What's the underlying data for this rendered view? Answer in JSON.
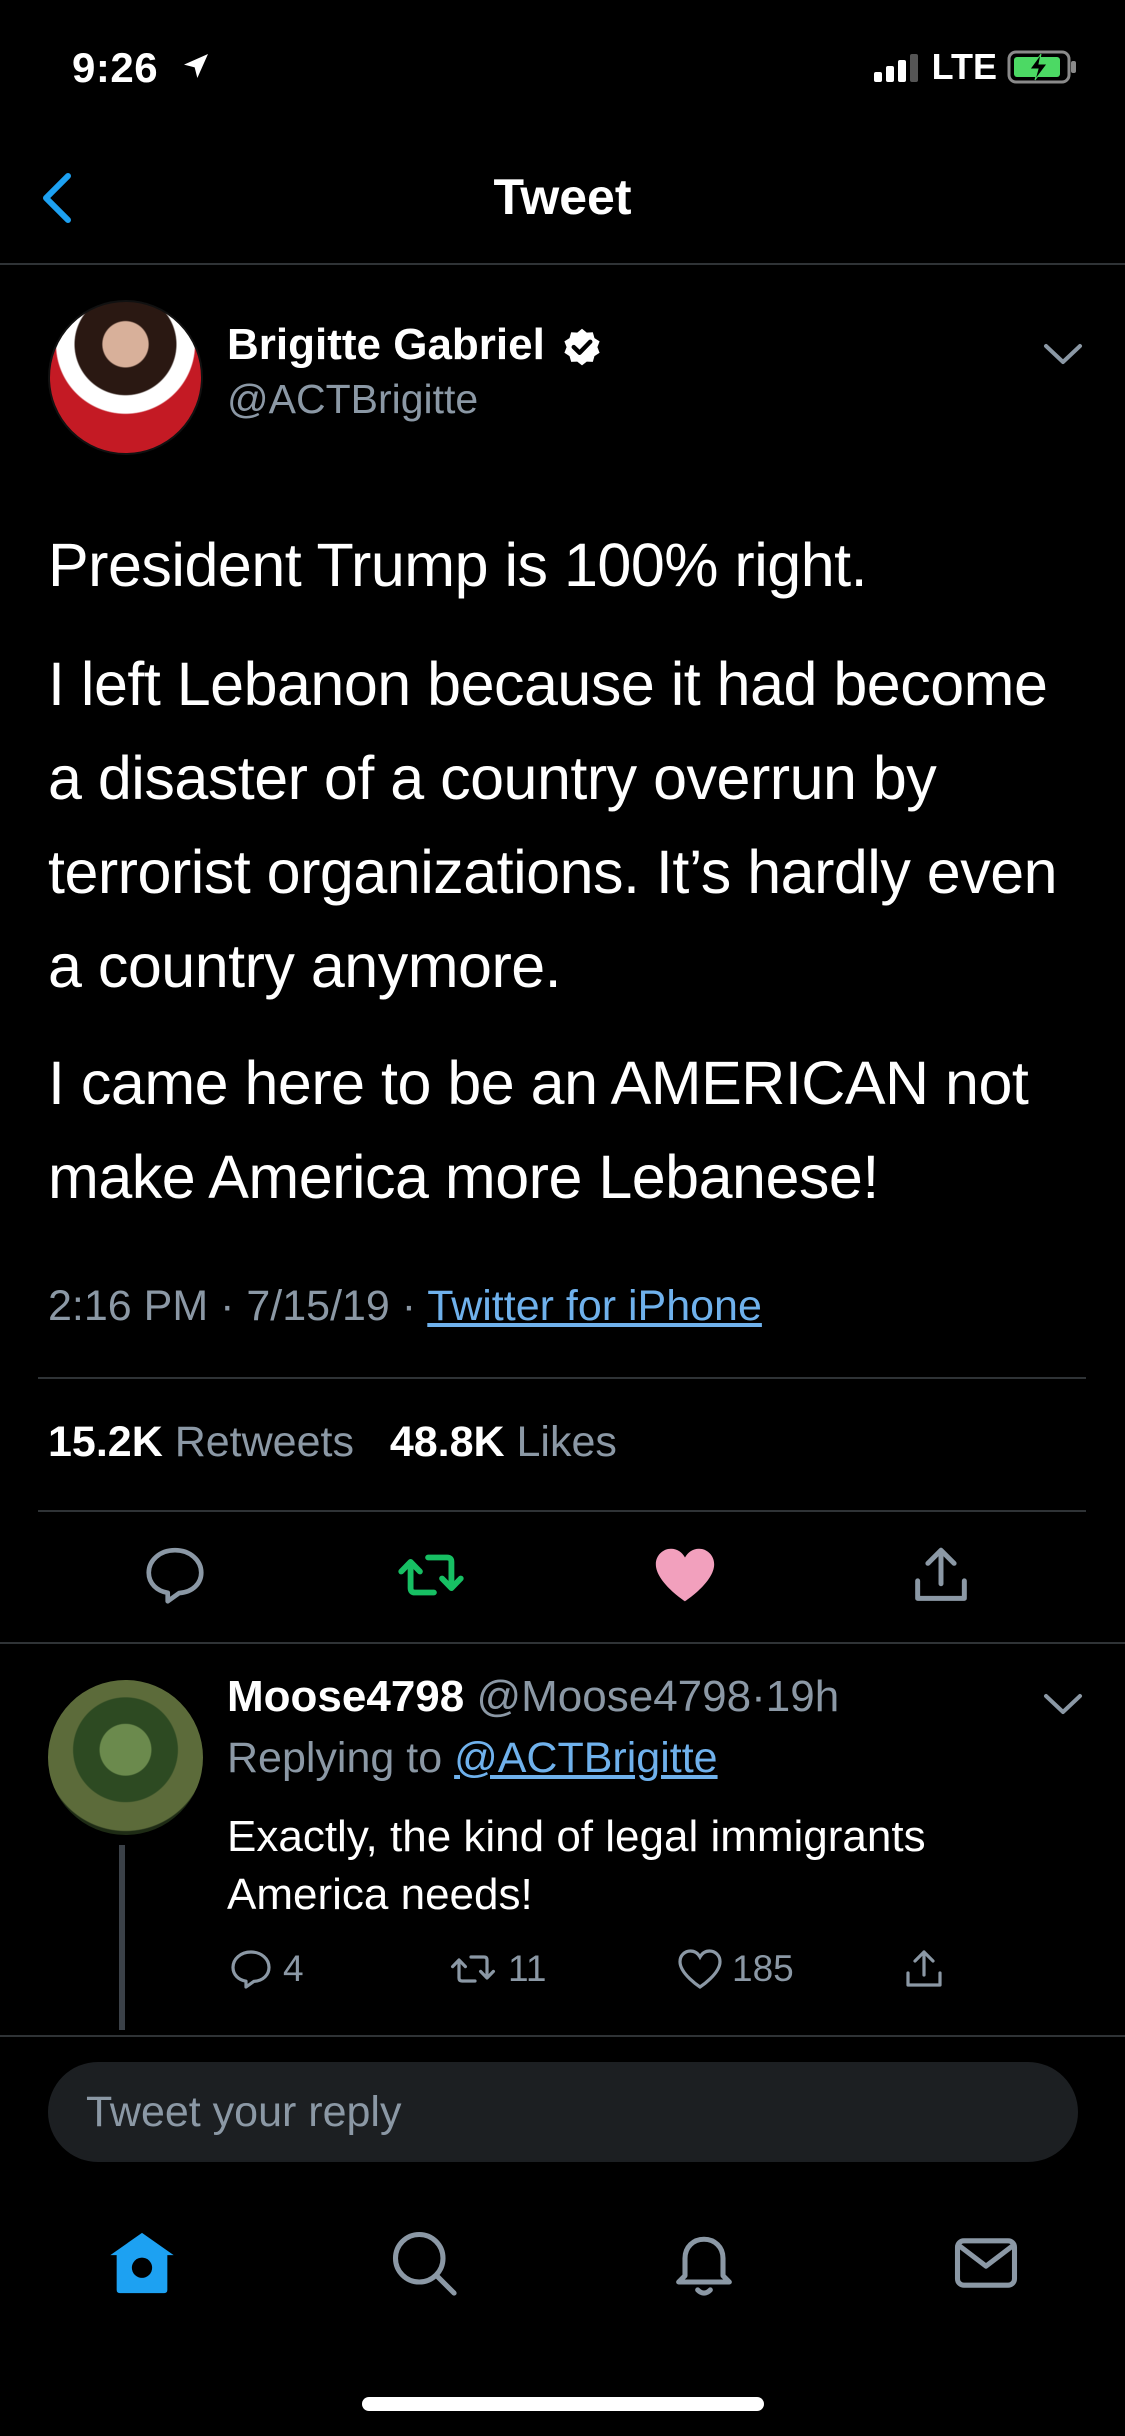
{
  "status_bar": {
    "time": "9:26",
    "network": "LTE"
  },
  "header": {
    "title": "Tweet"
  },
  "tweet": {
    "author_name": "Brigitte Gabriel",
    "author_handle": "@ACTBrigitte",
    "paragraphs": [
      "President Trump is 100% right.",
      "I left Lebanon because it had become a disaster of a country overrun by terrorist organizations. It’s hardly even a country anymore.",
      "I came here to be an AMERICAN not make America more Lebanese!"
    ],
    "time": "2:16 PM",
    "date": "7/15/19",
    "separator": "·",
    "source": "Twitter for iPhone",
    "retweets_count": "15.2K",
    "retweets_label": "Retweets",
    "likes_count": "48.8K",
    "likes_label": "Likes"
  },
  "reply": {
    "name": "Moose4798",
    "handle": "@Moose4798",
    "separator": "·",
    "time": "19h",
    "replying_to_label": "Replying to",
    "replying_to_handle": "@ACTBrigitte",
    "text": "Exactly, the kind of legal immigrants America needs!",
    "reply_count": "4",
    "retweet_count": "11",
    "like_count": "185"
  },
  "compose": {
    "placeholder": "Tweet your reply"
  },
  "colors": {
    "accent": "#1da1f2",
    "retweet_green": "#17bf63",
    "like_pink": "#e0245e",
    "muted": "#8b98a5"
  },
  "icons": {
    "back": "chevron-left-icon",
    "verified": "verified-badge-icon",
    "tabs": [
      "home-icon",
      "search-icon",
      "bell-icon",
      "mail-icon"
    ]
  }
}
